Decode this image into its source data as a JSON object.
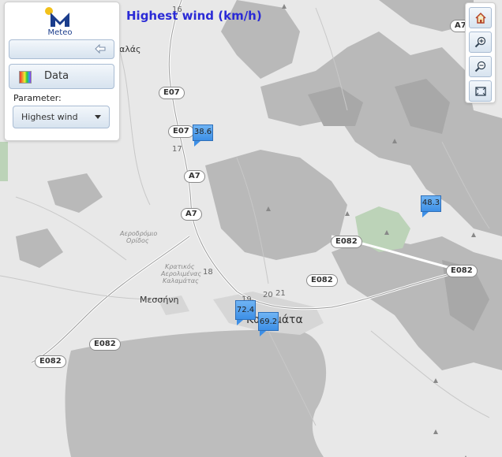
{
  "title": "Highest wind (km/h)",
  "logo": {
    "text": "Meteo"
  },
  "panel": {
    "data_button_label": "Data",
    "parameter_label": "Parameter:",
    "parameter_value": "Highest wind"
  },
  "map_labels": {
    "kalamata": "Καλαμάτα",
    "messini": "Μεσσήνη",
    "kalas": "αλάς",
    "airport": "Αεροδρόμιο Καλαμάτας (Κρατικός Αερολιμένας Καλαμάτας)",
    "airport_line1": "Αεροδρόμιο",
    "airport_line2": "Ορίδος",
    "airport_line3": "Κρατικός",
    "airport_line4": "Αερολιμένας",
    "airport_line5": "Καλαμάτας"
  },
  "roads": {
    "e07_a": "E07",
    "e07_b": "E07",
    "a7_a": "A7",
    "a7_b": "A7",
    "a7_top": "A7",
    "e082_center": "E082",
    "e082_right1": "E082",
    "e082_right2": "E082",
    "e082_left1": "E082",
    "e082_left2": "E082",
    "num_16": "16",
    "num_17": "17",
    "num_18": "18",
    "num_19": "19",
    "num_20": "20",
    "num_21": "21"
  },
  "stations": [
    {
      "value": "38.6"
    },
    {
      "value": "48.3"
    },
    {
      "value": "72.4"
    },
    {
      "value": "69.2"
    }
  ],
  "colors": {
    "title": "#2a2ad6",
    "marker": "#3d8fe6",
    "sea": "#bdbdbd",
    "mountains": "#b5b5b5"
  }
}
